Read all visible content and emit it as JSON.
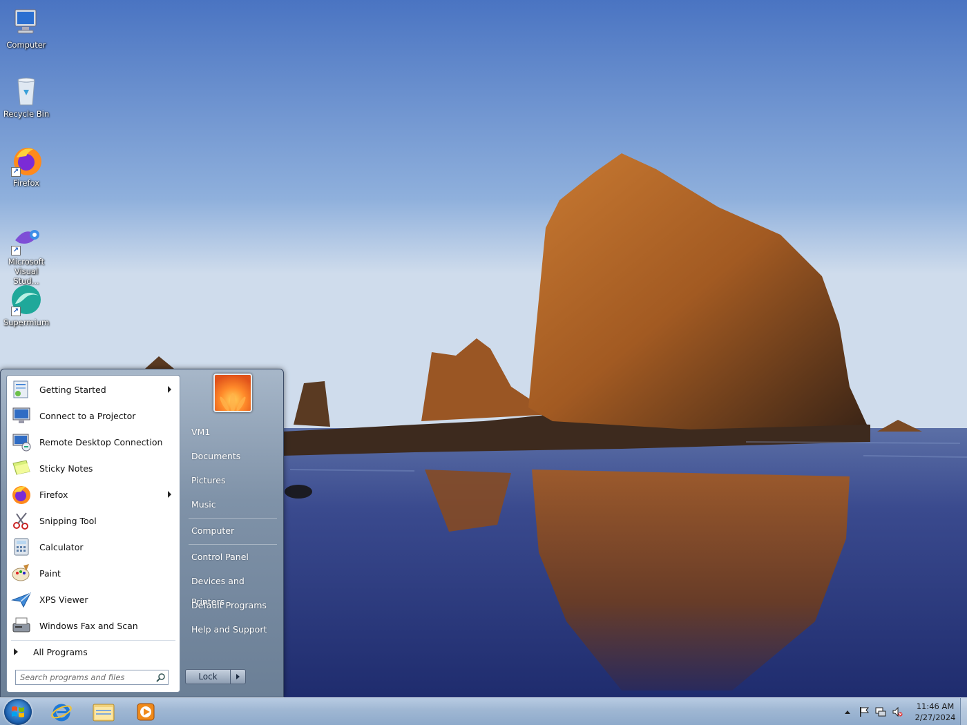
{
  "desktop": {
    "icons": [
      {
        "label": "Computer"
      },
      {
        "label": "Recycle Bin"
      },
      {
        "label": "Firefox"
      },
      {
        "label": "Microsoft Visual Stud..."
      },
      {
        "label": "Supermium"
      }
    ]
  },
  "start_menu": {
    "programs": [
      {
        "label": "Getting Started",
        "has_submenu": true,
        "icon": "getting-started-icon"
      },
      {
        "label": "Connect to a Projector",
        "has_submenu": false,
        "icon": "projector-icon"
      },
      {
        "label": "Remote Desktop Connection",
        "has_submenu": false,
        "icon": "remote-desktop-icon"
      },
      {
        "label": "Sticky Notes",
        "has_submenu": false,
        "icon": "sticky-notes-icon"
      },
      {
        "label": "Firefox",
        "has_submenu": true,
        "icon": "firefox-icon"
      },
      {
        "label": "Snipping Tool",
        "has_submenu": false,
        "icon": "scissors-icon"
      },
      {
        "label": "Calculator",
        "has_submenu": false,
        "icon": "calculator-icon"
      },
      {
        "label": "Paint",
        "has_submenu": false,
        "icon": "paint-icon"
      },
      {
        "label": "XPS Viewer",
        "has_submenu": false,
        "icon": "xps-viewer-icon"
      },
      {
        "label": "Windows Fax and Scan",
        "has_submenu": false,
        "icon": "fax-icon"
      }
    ],
    "all_programs_label": "All Programs",
    "search_placeholder": "Search programs and files",
    "right_links": {
      "user": "VM1",
      "documents": "Documents",
      "pictures": "Pictures",
      "music": "Music",
      "computer": "Computer",
      "control_panel": "Control Panel",
      "devices_printers": "Devices and Printers",
      "default_programs": "Default Programs",
      "help_support": "Help and Support"
    },
    "lock_label": "Lock"
  },
  "taskbar": {
    "pinned": [
      "internet-explorer-icon",
      "file-explorer-icon",
      "media-player-icon"
    ],
    "tray": {
      "time": "11:46 AM",
      "date": "2/27/2024"
    }
  },
  "colors": {
    "sky_top": "#4b76c4",
    "sky_bottom": "#c9d8ea",
    "rock": "#b86a2a",
    "water": "#2c3f86"
  }
}
